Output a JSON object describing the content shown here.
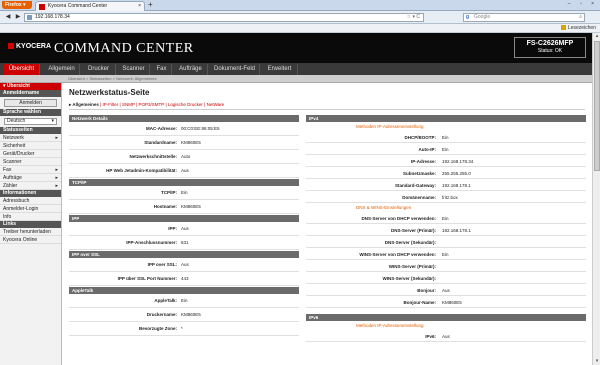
{
  "browser": {
    "menu_button": "Firefox ▾",
    "tab_title": "Kyocera Command Center",
    "tab_close": "×",
    "new_tab": "+",
    "window_controls": "– ▫ ×",
    "back": "◀",
    "forward": "▶",
    "url": "192.168.178.34",
    "url_actions": "☆ ▾ C",
    "search_engine": "g",
    "search_placeholder": "Google",
    "search_icon": "⌕",
    "bookmarks_label": "Lesezeichen"
  },
  "header": {
    "brand": "KYOCERA",
    "app_title": "COMMAND CENTER",
    "model": "FS-C2626MFP",
    "status": "Status: OK"
  },
  "main_tabs": [
    {
      "label": "Übersicht"
    },
    {
      "label": "Allgemein"
    },
    {
      "label": "Drucker"
    },
    {
      "label": "Scanner"
    },
    {
      "label": "Fax"
    },
    {
      "label": "Aufträge"
    },
    {
      "label": "Dokument-Feld"
    },
    {
      "label": "Erweitert"
    }
  ],
  "breadcrumb": "Übersicht > Statusseiten > Netzwerk: Allgemeines",
  "sidebar": {
    "top_header": "▾ Übersicht",
    "login_header": "Anmeldername",
    "login_button": "Anmelden",
    "lang_header": "Sprache wählen",
    "lang_value": "Deutsch",
    "lang_arrow": "▾",
    "status_header": "Statusseiten",
    "status_items": [
      {
        "label": "Netzwerk",
        "arrow": "▸"
      },
      {
        "label": "Sicherheit",
        "arrow": ""
      },
      {
        "label": "Gerät/Drucker",
        "arrow": ""
      },
      {
        "label": "Scanner",
        "arrow": ""
      },
      {
        "label": "Fax",
        "arrow": "▸"
      },
      {
        "label": "Aufträge",
        "arrow": "▸"
      },
      {
        "label": "Zähler",
        "arrow": "▸"
      }
    ],
    "info_header": "Informationen",
    "info_items": [
      {
        "label": "Adressbuch"
      },
      {
        "label": "Anmelder-Login"
      },
      {
        "label": "Info"
      }
    ],
    "links_header": "Links",
    "links_items": [
      {
        "label": "Treiber herunterladen"
      },
      {
        "label": "Kyocera Online"
      }
    ]
  },
  "page": {
    "title": "Netzwerkstatus-Seite",
    "subtabs": {
      "active": "▸ Allgemeines",
      "links": " | IP-Filter | SNMP | POP3/SMTP | Logische Drucker | NetWare"
    }
  },
  "left_sections": [
    {
      "title": "Netzwerk Details",
      "rows": [
        {
          "k": "MAC-Adresse:",
          "v": "00:C0:EE:86:05:E5"
        },
        {
          "k": "Standardname:",
          "v": "KM860E5"
        },
        {
          "k": "Netzwerkschnittstelle:",
          "v": "Auto"
        },
        {
          "k": "HP Web Jetadmin-Kompatibilität:",
          "v": "Aus"
        }
      ]
    },
    {
      "title": "TCP/IP",
      "rows": [
        {
          "k": "TCP/IP:",
          "v": "Ein"
        },
        {
          "k": "Hostname:",
          "v": "KM860E5"
        }
      ]
    },
    {
      "title": "IPP",
      "rows": [
        {
          "k": "IPP:",
          "v": "Aus"
        },
        {
          "k": "IPP-Anschlussnummer:",
          "v": "631"
        }
      ]
    },
    {
      "title": "IPP over SSL",
      "rows": [
        {
          "k": "IPP over SSL:",
          "v": "Aus"
        },
        {
          "k": "IPP über SSL Port Nummer:",
          "v": "443"
        }
      ]
    },
    {
      "title": "AppleTalk",
      "rows": [
        {
          "k": "AppleTalk:",
          "v": "Ein"
        },
        {
          "k": "Druckername:",
          "v": "KM860E5"
        },
        {
          "k": "Bevorzugte Zone:",
          "v": "*"
        }
      ]
    }
  ],
  "right": {
    "ipv4_title": "IPv4",
    "sub1": "Methoden IP-Adresseneinstellung",
    "rows1": [
      {
        "k": "DHCP/BOOTP:",
        "v": "Ein"
      },
      {
        "k": "Auto-IP:",
        "v": "Ein"
      },
      {
        "k": "IP-Adresse:",
        "v": "192.168.178.34"
      },
      {
        "k": "Subnetzmaske:",
        "v": "255.255.255.0"
      },
      {
        "k": "Standard-Gateway:",
        "v": "192.168.178.1"
      },
      {
        "k": "Domänenname:",
        "v": "fritz.box"
      }
    ],
    "sub2": "DNS & WINS-Einstellungen",
    "rows2": [
      {
        "k": "DNS-Server von DHCP verwenden:",
        "v": "Ein"
      },
      {
        "k": "DNS-Server (Primär):",
        "v": "192.168.178.1"
      },
      {
        "k": "DNS-Server (Sekundär):",
        "v": ""
      },
      {
        "k": "WINS-Server von DHCP verwenden:",
        "v": "Ein"
      },
      {
        "k": "WINS-Server (Primär):",
        "v": ""
      },
      {
        "k": "WINS-Server (Sekundär):",
        "v": ""
      },
      {
        "k": "Bonjour:",
        "v": "Aus"
      },
      {
        "k": "Bonjour-Name:",
        "v": "KM860E5"
      }
    ],
    "ipv6_title": "IPv6",
    "sub3": "Methoden IP-Adresseneinstellung",
    "rows3": [
      {
        "k": "IPv6:",
        "v": "Aus"
      }
    ]
  },
  "scrollbar": {
    "up": "▴",
    "down": "▾"
  }
}
